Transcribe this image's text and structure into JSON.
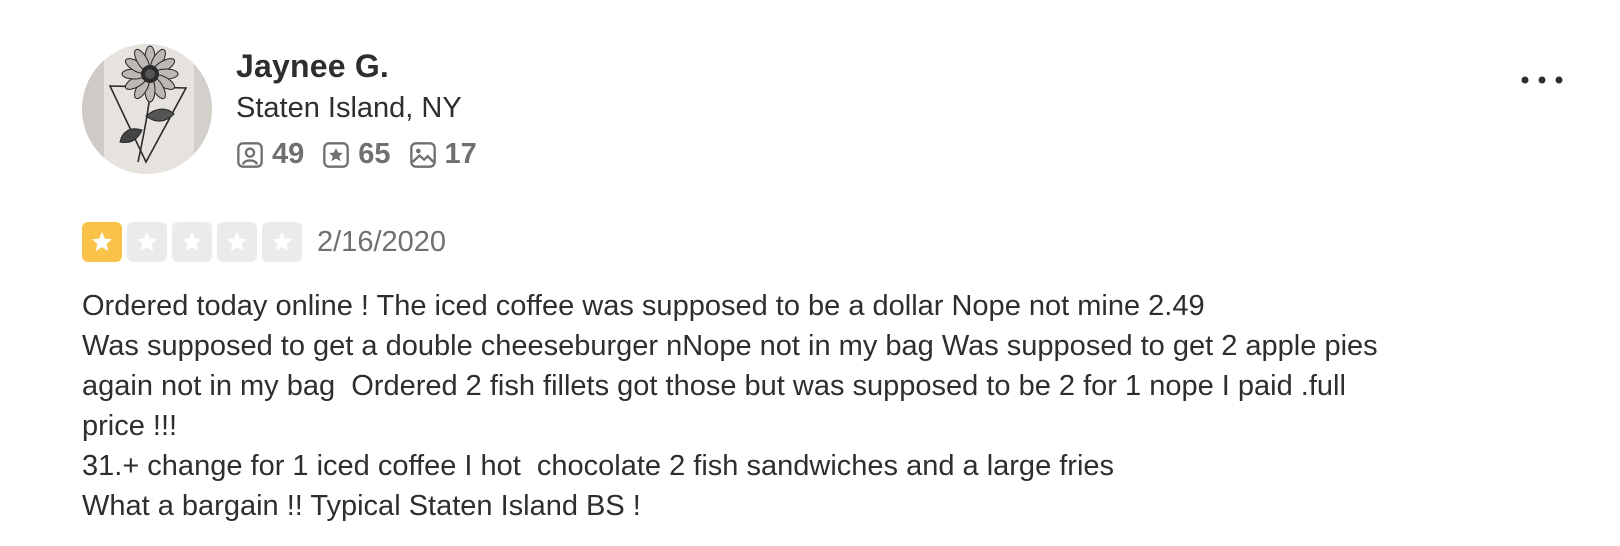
{
  "reviewer": {
    "name": "Jaynee G.",
    "location": "Staten Island, NY",
    "avatar_icon": "sunflower-tattoo-avatar",
    "stats": {
      "friends": "49",
      "reviews": "65",
      "photos": "17"
    }
  },
  "review": {
    "rating": 1,
    "max_rating": 5,
    "date": "2/16/2020",
    "lines": [
      "Ordered today online ! The iced coffee was supposed to be a dollar Nope not mine 2.49",
      "Was supposed to get a double cheeseburger nNope not in my bag Was supposed to get 2 apple pies",
      "again not in my bag  Ordered 2 fish fillets got those but was supposed to be 2 for 1 nope I paid .full",
      "price !!!",
      "31.+ change for 1 iced coffee I hot  chocolate 2 fish sandwiches and a large fries",
      "What a bargain !! Typical Staten Island BS !"
    ]
  },
  "colors": {
    "star_filled": "#f9c349",
    "star_empty": "#ebebeb",
    "text_primary": "#2d2e2f",
    "text_secondary": "#6e7072"
  },
  "icons": {
    "friends": "friends-icon",
    "reviews": "reviews-star-icon",
    "photos": "photos-icon",
    "menu": "more-options-icon"
  }
}
